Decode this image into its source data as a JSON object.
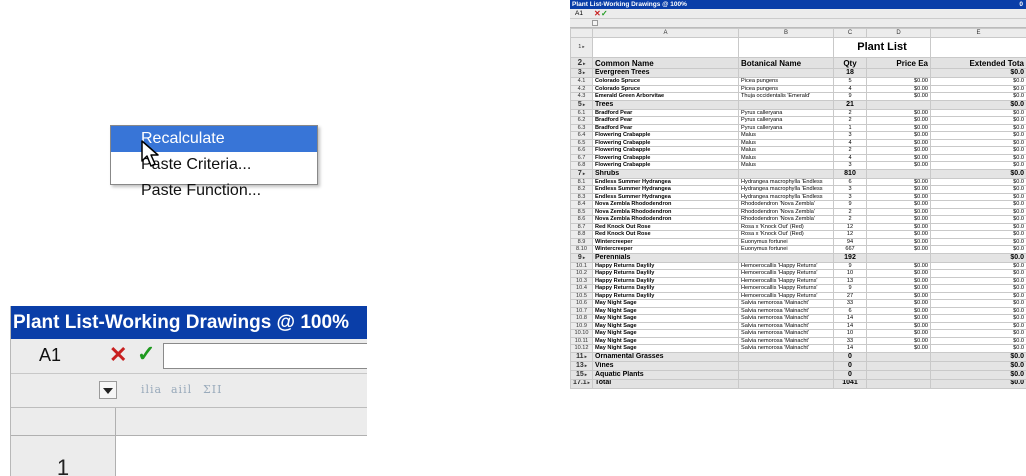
{
  "zoom": {
    "title": "Plant List-Working Drawings @ 100%",
    "cell_ref": "A1",
    "cancel_glyph": "✕",
    "accept_glyph": "✓",
    "toolbar_icons": [
      "ilia",
      "aiil",
      "ΣII"
    ],
    "row_number": "1",
    "menu_items": [
      {
        "label": "Recalculate",
        "highlighted": true
      },
      {
        "label": "Paste Criteria...",
        "highlighted": false
      },
      {
        "label": "Paste Function...",
        "highlighted": false
      }
    ]
  },
  "window": {
    "title": "Plant List-Working Drawings @ 100%",
    "title_right": "0",
    "cell_ref": "A1",
    "cancel_glyph": "✕",
    "accept_glyph": "✓",
    "columns": [
      "A",
      "B",
      "C",
      "D",
      "E"
    ],
    "sheet_title": "Plant List",
    "headers": [
      "Common Name",
      "Botanical Name",
      "Qty",
      "Price Ea",
      "Extended Tota"
    ],
    "rows": [
      {
        "rn": "3",
        "kind": "grp",
        "name": "Evergreen Trees",
        "qty": "18",
        "ext": "$0.0"
      },
      {
        "rn": "4.1",
        "kind": "item",
        "name": "Colorado Spruce",
        "bot": "Picea pungens",
        "qty": "5",
        "price": "$0.00",
        "ext": "$0.0"
      },
      {
        "rn": "4.2",
        "kind": "item",
        "name": "Colorado Spruce",
        "bot": "Picea pungens",
        "qty": "4",
        "price": "$0.00",
        "ext": "$0.0"
      },
      {
        "rn": "4.3",
        "kind": "item",
        "name": "Emerald Green Arborvitae",
        "bot": "Thuja occidentalis 'Emerald'",
        "qty": "9",
        "price": "$0.00",
        "ext": "$0.0"
      },
      {
        "rn": "5",
        "kind": "grp",
        "name": "Trees",
        "qty": "21",
        "ext": "$0.0"
      },
      {
        "rn": "6.1",
        "kind": "item",
        "name": "Bradford Pear",
        "bot": "Pyrus calleryana",
        "qty": "2",
        "price": "$0.00",
        "ext": "$0.0"
      },
      {
        "rn": "6.2",
        "kind": "item",
        "name": "Bradford Pear",
        "bot": "Pyrus calleryana",
        "qty": "2",
        "price": "$0.00",
        "ext": "$0.0"
      },
      {
        "rn": "6.3",
        "kind": "item",
        "name": "Bradford Pear",
        "bot": "Pyrus calleryana",
        "qty": "1",
        "price": "$0.00",
        "ext": "$0.0"
      },
      {
        "rn": "6.4",
        "kind": "item",
        "name": "Flowering Crabapple",
        "bot": "Malus",
        "qty": "3",
        "price": "$0.00",
        "ext": "$0.0"
      },
      {
        "rn": "6.5",
        "kind": "item",
        "name": "Flowering Crabapple",
        "bot": "Malus",
        "qty": "4",
        "price": "$0.00",
        "ext": "$0.0"
      },
      {
        "rn": "6.6",
        "kind": "item",
        "name": "Flowering Crabapple",
        "bot": "Malus",
        "qty": "2",
        "price": "$0.00",
        "ext": "$0.0"
      },
      {
        "rn": "6.7",
        "kind": "item",
        "name": "Flowering Crabapple",
        "bot": "Malus",
        "qty": "4",
        "price": "$0.00",
        "ext": "$0.0"
      },
      {
        "rn": "6.8",
        "kind": "item",
        "name": "Flowering Crabapple",
        "bot": "Malus",
        "qty": "3",
        "price": "$0.00",
        "ext": "$0.0"
      },
      {
        "rn": "7",
        "kind": "grp",
        "name": "Shrubs",
        "qty": "810",
        "ext": "$0.0"
      },
      {
        "rn": "8.1",
        "kind": "item",
        "name": "Endless Summer Hydrangea",
        "bot": "Hydrangea macrophylla 'Endless",
        "qty": "6",
        "price": "$0.00",
        "ext": "$0.0"
      },
      {
        "rn": "8.2",
        "kind": "item",
        "name": "Endless Summer Hydrangea",
        "bot": "Hydrangea macrophylla 'Endless",
        "qty": "3",
        "price": "$0.00",
        "ext": "$0.0"
      },
      {
        "rn": "8.3",
        "kind": "item",
        "name": "Endless Summer Hydrangea",
        "bot": "Hydrangea macrophylla 'Endless",
        "qty": "3",
        "price": "$0.00",
        "ext": "$0.0"
      },
      {
        "rn": "8.4",
        "kind": "item",
        "name": "Nova Zembla Rhododendron",
        "bot": "Rhododendron 'Nova Zembla'",
        "qty": "9",
        "price": "$0.00",
        "ext": "$0.0"
      },
      {
        "rn": "8.5",
        "kind": "item",
        "name": "Nova Zembla Rhododendron",
        "bot": "Rhododendron 'Nova Zembla'",
        "qty": "2",
        "price": "$0.00",
        "ext": "$0.0"
      },
      {
        "rn": "8.6",
        "kind": "item",
        "name": "Nova Zembla Rhododendron",
        "bot": "Rhododendron 'Nova Zembla'",
        "qty": "2",
        "price": "$0.00",
        "ext": "$0.0"
      },
      {
        "rn": "8.7",
        "kind": "item",
        "name": "Red Knock Out Rose",
        "bot": "Rosa x 'Knock Out' (Red)",
        "qty": "12",
        "price": "$0.00",
        "ext": "$0.0"
      },
      {
        "rn": "8.8",
        "kind": "item",
        "name": "Red Knock Out Rose",
        "bot": "Rosa x 'Knock Out' (Red)",
        "qty": "12",
        "price": "$0.00",
        "ext": "$0.0"
      },
      {
        "rn": "8.9",
        "kind": "item",
        "name": "Wintercreeper",
        "bot": "Euonymus fortunei",
        "qty": "94",
        "price": "$0.00",
        "ext": "$0.0"
      },
      {
        "rn": "8.10",
        "kind": "item",
        "name": "Wintercreeper",
        "bot": "Euonymus fortunei",
        "qty": "667",
        "price": "$0.00",
        "ext": "$0.0"
      },
      {
        "rn": "9",
        "kind": "grp",
        "name": "Perennials",
        "qty": "192",
        "ext": "$0.0"
      },
      {
        "rn": "10.1",
        "kind": "item",
        "name": "Happy Returns Daylily",
        "bot": "Hemoerocallis 'Happy Returns'",
        "qty": "9",
        "price": "$0.00",
        "ext": "$0.0"
      },
      {
        "rn": "10.2",
        "kind": "item",
        "name": "Happy Returns Daylily",
        "bot": "Hemoerocallis 'Happy Returns'",
        "qty": "10",
        "price": "$0.00",
        "ext": "$0.0"
      },
      {
        "rn": "10.3",
        "kind": "item",
        "name": "Happy Returns Daylily",
        "bot": "Hemoerocallis 'Happy Returns'",
        "qty": "13",
        "price": "$0.00",
        "ext": "$0.0"
      },
      {
        "rn": "10.4",
        "kind": "item",
        "name": "Happy Returns Daylily",
        "bot": "Hemoerocallis 'Happy Returns'",
        "qty": "9",
        "price": "$0.00",
        "ext": "$0.0"
      },
      {
        "rn": "10.5",
        "kind": "item",
        "name": "Happy Returns Daylily",
        "bot": "Hemoerocallis 'Happy Returns'",
        "qty": "27",
        "price": "$0.00",
        "ext": "$0.0"
      },
      {
        "rn": "10.6",
        "kind": "item",
        "name": "May Night Sage",
        "bot": "Salvia nemorosa 'Mainacht'",
        "qty": "33",
        "price": "$0.00",
        "ext": "$0.0"
      },
      {
        "rn": "10.7",
        "kind": "item",
        "name": "May Night Sage",
        "bot": "Salvia nemorosa 'Mainacht'",
        "qty": "6",
        "price": "$0.00",
        "ext": "$0.0"
      },
      {
        "rn": "10.8",
        "kind": "item",
        "name": "May Night Sage",
        "bot": "Salvia nemorosa 'Mainacht'",
        "qty": "14",
        "price": "$0.00",
        "ext": "$0.0"
      },
      {
        "rn": "10.9",
        "kind": "item",
        "name": "May Night Sage",
        "bot": "Salvia nemorosa 'Mainacht'",
        "qty": "14",
        "price": "$0.00",
        "ext": "$0.0"
      },
      {
        "rn": "10.10",
        "kind": "item",
        "name": "May Night Sage",
        "bot": "Salvia nemorosa 'Mainacht'",
        "qty": "10",
        "price": "$0.00",
        "ext": "$0.0"
      },
      {
        "rn": "10.11",
        "kind": "item",
        "name": "May Night Sage",
        "bot": "Salvia nemorosa 'Mainacht'",
        "qty": "33",
        "price": "$0.00",
        "ext": "$0.0"
      },
      {
        "rn": "10.12",
        "kind": "item",
        "name": "May Night Sage",
        "bot": "Salvia nemorosa 'Mainacht'",
        "qty": "14",
        "price": "$0.00",
        "ext": "$0.0"
      },
      {
        "rn": "11",
        "kind": "grp",
        "name": "Ornamental Grasses",
        "qty": "0",
        "ext": "$0.0"
      },
      {
        "rn": "13",
        "kind": "grp",
        "name": "Vines",
        "qty": "0",
        "ext": "$0.0"
      },
      {
        "rn": "15",
        "kind": "grp",
        "name": "Aquatic Plants",
        "qty": "0",
        "ext": "$0.0"
      },
      {
        "rn": "17.1",
        "kind": "total",
        "name": "Total",
        "qty": "1041",
        "ext": "$0.0"
      }
    ]
  },
  "colors": {
    "title_bar": "#0a3ea8",
    "menu_highlight": "#3875d7",
    "cancel": "#c82020",
    "accept": "#1f9a1f"
  }
}
